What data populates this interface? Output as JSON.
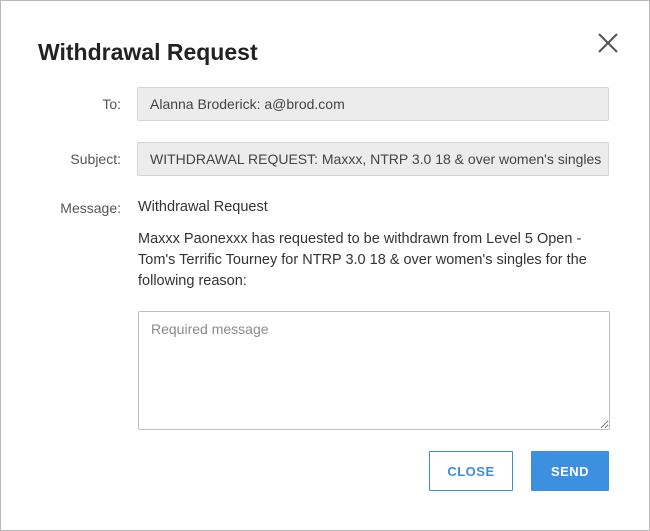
{
  "dialog": {
    "title": "Withdrawal Request",
    "close_icon": "close-icon"
  },
  "form": {
    "to_label": "To:",
    "to_value": "Alanna Broderick: a@brod.com",
    "subject_label": "Subject:",
    "subject_value": "WITHDRAWAL REQUEST: Maxxx, NTRP 3.0  18 & over women's singles",
    "message_label": "Message:",
    "message_heading": "Withdrawal Request",
    "message_body": "Maxxx Paonexxx has requested to be withdrawn from Level 5 Open - Tom's Terrific Tourney for NTRP 3.0 18 & over women's singles for the following reason:",
    "message_placeholder": "Required message"
  },
  "buttons": {
    "close_label": "CLOSE",
    "send_label": "SEND"
  },
  "colors": {
    "accent": "#3d8fdf",
    "field_background": "#ececec",
    "title_text": "#222222"
  }
}
